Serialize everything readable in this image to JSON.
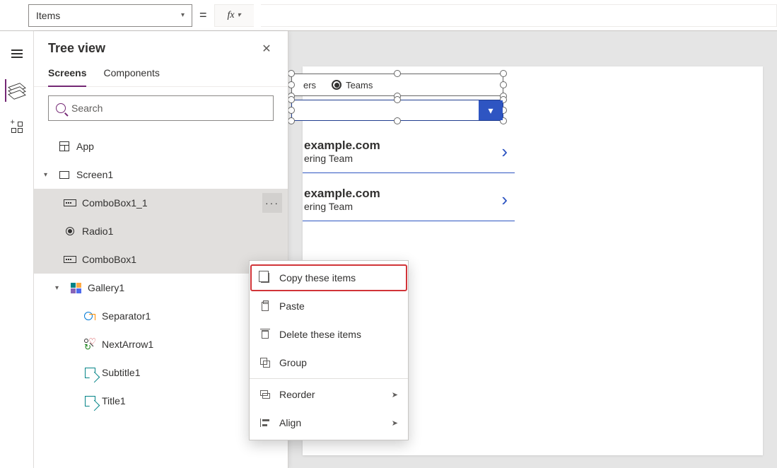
{
  "formula": {
    "property": "Items",
    "equals": "=",
    "fx": "fx"
  },
  "treeview": {
    "title": "Tree view",
    "tabs": {
      "screens": "Screens",
      "components": "Components"
    },
    "search_placeholder": "Search",
    "items": {
      "app": "App",
      "screen1": "Screen1",
      "combobox1_1": "ComboBox1_1",
      "radio1": "Radio1",
      "combobox1": "ComboBox1",
      "gallery1": "Gallery1",
      "separator1": "Separator1",
      "nextarrow1": "NextArrow1",
      "subtitle1": "Subtitle1",
      "title1": "Title1"
    }
  },
  "canvas": {
    "radio": {
      "opt1": "ers",
      "opt2": "Teams"
    },
    "gallery": [
      {
        "title": "example.com",
        "subtitle": "ering Team"
      },
      {
        "title": "example.com",
        "subtitle": "ering Team"
      }
    ]
  },
  "context_menu": {
    "copy": "Copy these items",
    "paste": "Paste",
    "delete": "Delete these items",
    "group": "Group",
    "reorder": "Reorder",
    "align": "Align"
  }
}
